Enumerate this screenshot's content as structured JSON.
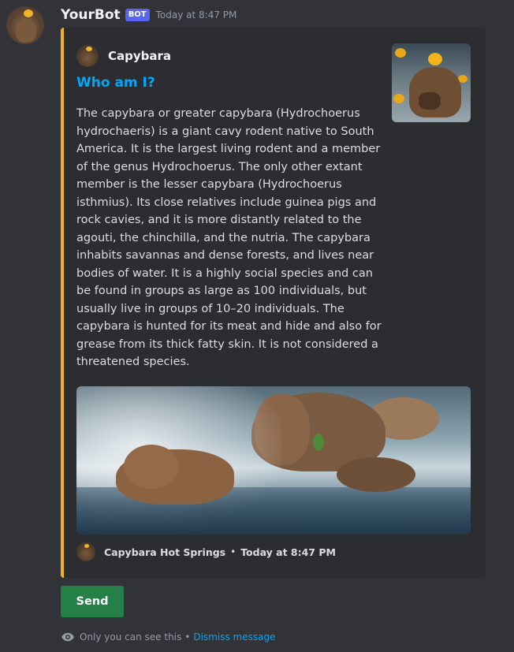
{
  "message": {
    "username": "YourBot",
    "bot_tag": "BOT",
    "timestamp": "Today at 8:47 PM"
  },
  "embed": {
    "accent_color": "#f5b020",
    "author_name": "Capybara",
    "title": "Who am I?",
    "description": "The capybara or greater capybara (Hydrochoerus hydrochaeris) is a giant cavy rodent native to South America. It is the largest living rodent and a member of the genus Hydrochoerus. The only other extant member is the lesser capybara (Hydrochoerus isthmius). Its close relatives include guinea pigs and rock cavies, and it is more distantly related to the agouti, the chinchilla, and the nutria. The capybara inhabits savannas and dense forests, and lives near bodies of water. It is a highly social species and can be found in groups as large as 100 individuals, but usually live in groups of 10–20 individuals. The capybara is hunted for its meat and hide and also for grease from its thick fatty skin. It is not considered a threatened species.",
    "footer_text": "Capybara Hot Springs",
    "footer_separator": "•",
    "footer_timestamp": "Today at 8:47 PM"
  },
  "components": {
    "send_label": "Send"
  },
  "ephemeral": {
    "notice": "Only you can see this",
    "separator": "•",
    "dismiss_label": "Dismiss message"
  },
  "colors": {
    "background": "#313338",
    "embed_background": "#2b2d31",
    "link": "#00a8fc",
    "button_success": "#248046",
    "bot_tag": "#5865f2"
  }
}
